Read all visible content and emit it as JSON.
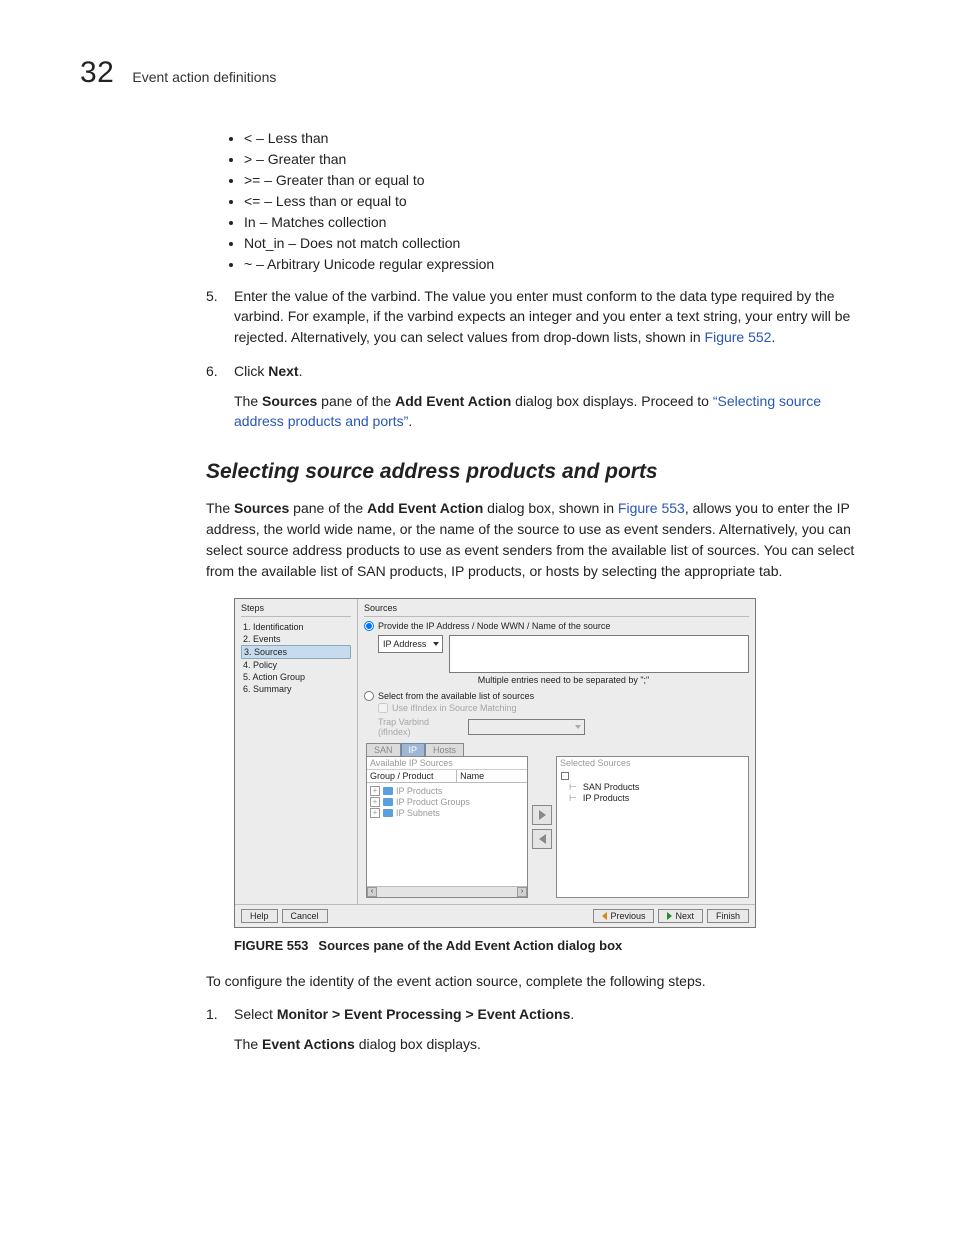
{
  "header": {
    "chapter_number": "32",
    "chapter_title": "Event action definitions"
  },
  "operators": [
    "< – Less than",
    "> – Greater than",
    ">= – Greater than or equal to",
    "<= – Less than or equal to",
    "In – Matches collection",
    "Not_in – Does not match collection",
    "~ – Arbitrary Unicode regular expression"
  ],
  "step5": {
    "pre": "Enter the value of the varbind. The value you enter must conform to the data type required by the varbind. For example, if the varbind expects an integer and you enter a text string, your entry will be rejected. Alternatively, you can select values from drop-down lists, shown in ",
    "link": "Figure 552",
    "post": "."
  },
  "step6": {
    "click": "Click ",
    "next": "Next",
    "period": ".",
    "sub_pre": "The ",
    "sub_b1": "Sources",
    "sub_mid1": " pane of the ",
    "sub_b2": "Add Event Action",
    "sub_mid2": " dialog box displays. Proceed to ",
    "sub_link": "“Selecting source address products and ports”",
    "sub_post": "."
  },
  "section_title": "Selecting source address products and ports",
  "section_para": {
    "p1a": "The ",
    "p1b": "Sources",
    "p1c": " pane of the ",
    "p1d": "Add Event Action",
    "p1e": " dialog box, shown in ",
    "p1link": "Figure 553",
    "p1f": ", allows you to enter the IP address, the world wide name, or the name of the source to use as event senders. Alternatively, you can select source address products to use as event senders from the available list of sources. You can select from the available list of SAN products, IP products, or hosts by selecting the appropriate tab."
  },
  "dialog": {
    "steps_header": "Steps",
    "steps": [
      "1. Identification",
      "2. Events",
      "3. Sources",
      "4. Policy",
      "5. Action Group",
      "6. Summary"
    ],
    "sources_header": "Sources",
    "radio_provide": "Provide the IP Address / Node WWN / Name of the source",
    "combo_ip": "IP Address",
    "hint": "Multiple entries need to be separated by \";\"",
    "radio_select": "Select from the available list of sources",
    "chk_ifindex": "Use ifIndex in Source Matching",
    "trap_label": "Trap Varbind (ifIndex)",
    "tabs": [
      "SAN",
      "IP",
      "Hosts"
    ],
    "avail_header": "Available IP Sources",
    "col_group": "Group / Product",
    "col_name": "Name",
    "left_nodes": [
      "IP Products",
      "IP Product Groups",
      "IP Subnets"
    ],
    "sel_header": "Selected Sources",
    "right_nodes": [
      "SAN Products",
      "IP Products"
    ],
    "btn_help": "Help",
    "btn_cancel": "Cancel",
    "btn_prev": "Previous",
    "btn_next": "Next",
    "btn_finish": "Finish"
  },
  "figure": {
    "num": "FIGURE 553",
    "caption": "Sources pane of the Add Event Action dialog box"
  },
  "after_fig": "To configure the identity of the event action source, complete the following steps.",
  "step_a": {
    "pre": "Select ",
    "bold": "Monitor > Event Processing > Event Actions",
    "post": ".",
    "sub_pre": "The ",
    "sub_b": "Event Actions",
    "sub_post": " dialog box displays."
  }
}
